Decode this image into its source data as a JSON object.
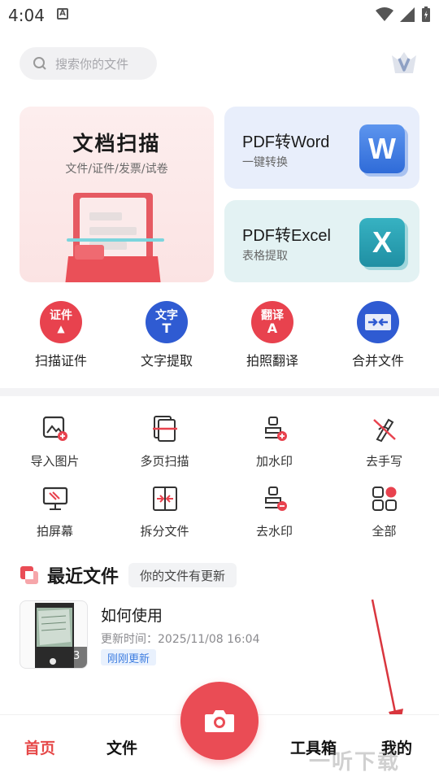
{
  "status_bar": {
    "time": "4:04"
  },
  "search": {
    "placeholder": "搜索你的文件"
  },
  "cards": {
    "scan": {
      "title": "文档扫描",
      "subtitle": "文件/证件/发票/试卷"
    },
    "pdf_word": {
      "title": "PDF转Word",
      "subtitle": "一键转换",
      "badge": "W"
    },
    "pdf_excel": {
      "title": "PDF转Excel",
      "subtitle": "表格提取",
      "badge": "X"
    }
  },
  "quick_actions": [
    {
      "label": "扫描证件",
      "icon_text": "证件",
      "color": "#e8424e",
      "icon": "id-card-icon"
    },
    {
      "label": "文字提取",
      "icon_text": "文字",
      "icon_text2": "T",
      "color": "#2f5bd2",
      "icon": "text-extract-icon"
    },
    {
      "label": "拍照翻译",
      "icon_text": "翻译",
      "icon_text2": "A",
      "color": "#e8424e",
      "icon": "translate-icon"
    },
    {
      "label": "合并文件",
      "icon_text": "",
      "color": "#2f5bd2",
      "icon": "merge-icon"
    }
  ],
  "tools": [
    {
      "label": "导入图片",
      "icon": "import-image-icon"
    },
    {
      "label": "多页扫描",
      "icon": "multi-page-scan-icon"
    },
    {
      "label": "加水印",
      "icon": "add-watermark-icon"
    },
    {
      "label": "去手写",
      "icon": "remove-handwriting-icon"
    },
    {
      "label": "拍屏幕",
      "icon": "shoot-screen-icon"
    },
    {
      "label": "拆分文件",
      "icon": "split-file-icon"
    },
    {
      "label": "去水印",
      "icon": "remove-watermark-icon"
    },
    {
      "label": "全部",
      "icon": "all-tools-icon"
    }
  ],
  "recent": {
    "title": "最近文件",
    "tag": "你的文件有更新",
    "files": [
      {
        "name": "如何使用",
        "meta": "更新时间：2025/11/08 16:04",
        "chip": "刚刚更新",
        "pages": "3"
      }
    ]
  },
  "bottom_nav": {
    "home": "首页",
    "files": "文件",
    "tools": "工具箱",
    "mine": "我的"
  },
  "watermark": "一听下载",
  "colors": {
    "accent": "#ea4c55",
    "active_tab": "#e64848",
    "chip_text": "#3d7de0"
  }
}
